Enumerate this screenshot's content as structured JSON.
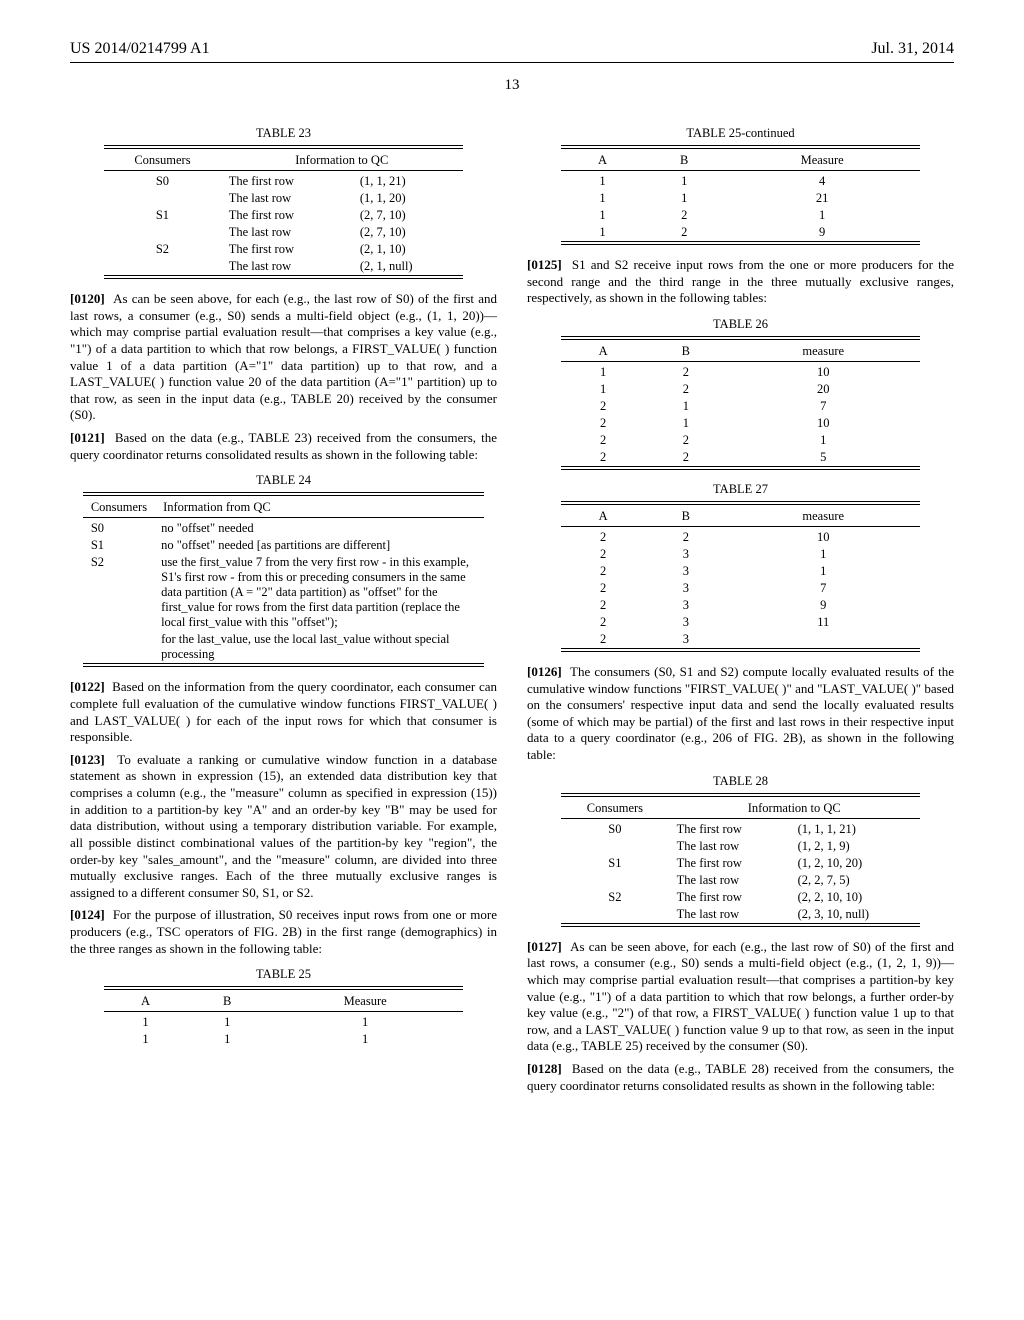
{
  "header": {
    "pub_number": "US 2014/0214799 A1",
    "pub_date": "Jul. 31, 2014",
    "page_num": "13"
  },
  "t23": {
    "caption": "TABLE 23",
    "h1": "Consumers",
    "h2": "Information to QC",
    "rows": [
      {
        "c": "S0",
        "d": "The first row",
        "v": "(1, 1, 21)"
      },
      {
        "c": "",
        "d": "The last row",
        "v": "(1, 1, 20)"
      },
      {
        "c": "S1",
        "d": "The first row",
        "v": "(2, 7, 10)"
      },
      {
        "c": "",
        "d": "The last row",
        "v": "(2, 7, 10)"
      },
      {
        "c": "S2",
        "d": "The first row",
        "v": "(2, 1, 10)"
      },
      {
        "c": "",
        "d": "The last row",
        "v": "(2, 1, null)"
      }
    ]
  },
  "p0120": {
    "num": "[0120]",
    "text": "As can be seen above, for each (e.g., the last row of S0) of the first and last rows, a consumer (e.g., S0) sends a multi-field object (e.g., (1, 1, 20))—which may comprise partial evaluation result—that comprises a key value (e.g., \"1\") of a data partition to which that row belongs, a FIRST_VALUE( ) function value 1 of a data partition (A=\"1\" data partition) up to that row, and a LAST_VALUE( ) function value 20 of the data partition (A=\"1\" partition) up to that row, as seen in the input data (e.g., TABLE 20) received by the consumer (S0)."
  },
  "p0121": {
    "num": "[0121]",
    "text": "Based on the data (e.g., TABLE 23) received from the consumers, the query coordinator returns consolidated results as shown in the following table:"
  },
  "t24": {
    "caption": "TABLE 24",
    "h1": "Consumers",
    "h2": "Information from QC",
    "r0": {
      "c": "S0",
      "d": "no \"offset\" needed"
    },
    "r1": {
      "c": "S1",
      "d": "no \"offset\" needed [as partitions are different]"
    },
    "r2": {
      "c": "S2",
      "d": "use the first_value 7 from the very first row - in this example, S1's first row - from this or preceding consumers in the same data partition (A = \"2\" data partition) as \"offset\" for the first_value for rows from the first data partition (replace the local first_value with this \"offset\");"
    },
    "r3": {
      "c": "",
      "d": "for the last_value, use the local last_value without special processing"
    }
  },
  "p0122": {
    "num": "[0122]",
    "text": "Based on the information from the query coordinator, each consumer can complete full evaluation of the cumulative window functions FIRST_VALUE( ) and LAST_VALUE( ) for each of the input rows for which that consumer is responsible."
  },
  "p0123": {
    "num": "[0123]",
    "text": "To evaluate a ranking or cumulative window function in a database statement as shown in expression (15), an extended data distribution key that comprises a column (e.g., the \"measure\" column as specified in expression (15)) in addition to a partition-by key \"A\" and an order-by key \"B\" may be used for data distribution, without using a temporary distribution variable. For example, all possible distinct combinational values of the partition-by key \"region\", the order-by key \"sales_amount\", and the \"measure\" column, are divided into three mutually exclusive ranges. Each of the three mutually exclusive ranges is assigned to a different consumer S0, S1, or S2."
  },
  "p0124": {
    "num": "[0124]",
    "text": "For the purpose of illustration, S0 receives input rows from one or more producers (e.g., TSC operators of FIG. 2B) in the first range (demographics) in the three ranges as shown in the following table:"
  },
  "t25": {
    "caption": "TABLE 25",
    "hA": "A",
    "hB": "B",
    "hM": "Measure",
    "a_rows": [
      {
        "a": "1",
        "b": "1",
        "m": "1"
      },
      {
        "a": "1",
        "b": "1",
        "m": "1"
      }
    ],
    "caption_cont": "TABLE 25-continued",
    "b_rows": [
      {
        "a": "1",
        "b": "1",
        "m": "4"
      },
      {
        "a": "1",
        "b": "1",
        "m": "21"
      },
      {
        "a": "1",
        "b": "2",
        "m": "1"
      },
      {
        "a": "1",
        "b": "2",
        "m": "9"
      }
    ]
  },
  "p0125": {
    "num": "[0125]",
    "text": "S1 and S2 receive input rows from the one or more producers for the second range and the third range in the three mutually exclusive ranges, respectively, as shown in the following tables:"
  },
  "t26": {
    "caption": "TABLE 26",
    "hA": "A",
    "hB": "B",
    "hM": "measure",
    "rows": [
      {
        "a": "1",
        "b": "2",
        "m": "10"
      },
      {
        "a": "1",
        "b": "2",
        "m": "20"
      },
      {
        "a": "2",
        "b": "1",
        "m": "7"
      },
      {
        "a": "2",
        "b": "1",
        "m": "10"
      },
      {
        "a": "2",
        "b": "2",
        "m": "1"
      },
      {
        "a": "2",
        "b": "2",
        "m": "5"
      }
    ]
  },
  "t27": {
    "caption": "TABLE 27",
    "hA": "A",
    "hB": "B",
    "hM": "measure",
    "rows": [
      {
        "a": "2",
        "b": "2",
        "m": "10"
      },
      {
        "a": "2",
        "b": "3",
        "m": "1"
      },
      {
        "a": "2",
        "b": "3",
        "m": "1"
      },
      {
        "a": "2",
        "b": "3",
        "m": "7"
      },
      {
        "a": "2",
        "b": "3",
        "m": "9"
      },
      {
        "a": "2",
        "b": "3",
        "m": "11"
      },
      {
        "a": "2",
        "b": "3",
        "m": ""
      }
    ]
  },
  "p0126": {
    "num": "[0126]",
    "text": "The consumers (S0, S1 and S2) compute locally evaluated results of the cumulative window functions \"FIRST_VALUE( )\" and \"LAST_VALUE( )\" based on the consumers' respective input data and send the locally evaluated results (some of which may be partial) of the first and last rows in their respective input data to a query coordinator (e.g., 206 of FIG. 2B), as shown in the following table:"
  },
  "t28": {
    "caption": "TABLE 28",
    "h1": "Consumers",
    "h2": "Information to QC",
    "rows": [
      {
        "c": "S0",
        "d": "The first row",
        "v": "(1, 1, 1, 21)"
      },
      {
        "c": "",
        "d": "The last row",
        "v": "(1, 2, 1, 9)"
      },
      {
        "c": "S1",
        "d": "The first row",
        "v": "(1, 2, 10, 20)"
      },
      {
        "c": "",
        "d": "The last row",
        "v": "(2, 2, 7, 5)"
      },
      {
        "c": "S2",
        "d": "The first row",
        "v": "(2, 2, 10, 10)"
      },
      {
        "c": "",
        "d": "The last row",
        "v": "(2, 3, 10, null)"
      }
    ]
  },
  "p0127": {
    "num": "[0127]",
    "text": "As can be seen above, for each (e.g., the last row of S0) of the first and last rows, a consumer (e.g., S0) sends a multi-field object (e.g., (1, 2, 1, 9))—which may comprise partial evaluation result—that comprises a partition-by key value (e.g., \"1\") of a data partition to which that row belongs, a further order-by key value (e.g., \"2\") of that row, a FIRST_VALUE( ) function value 1 up to that row, and a LAST_VALUE( ) function value 9 up to that row, as seen in the input data (e.g., TABLE 25) received by the consumer (S0)."
  },
  "p0128": {
    "num": "[0128]",
    "text": "Based on the data (e.g., TABLE 28) received from the consumers, the query coordinator returns consolidated results as shown in the following table:"
  }
}
